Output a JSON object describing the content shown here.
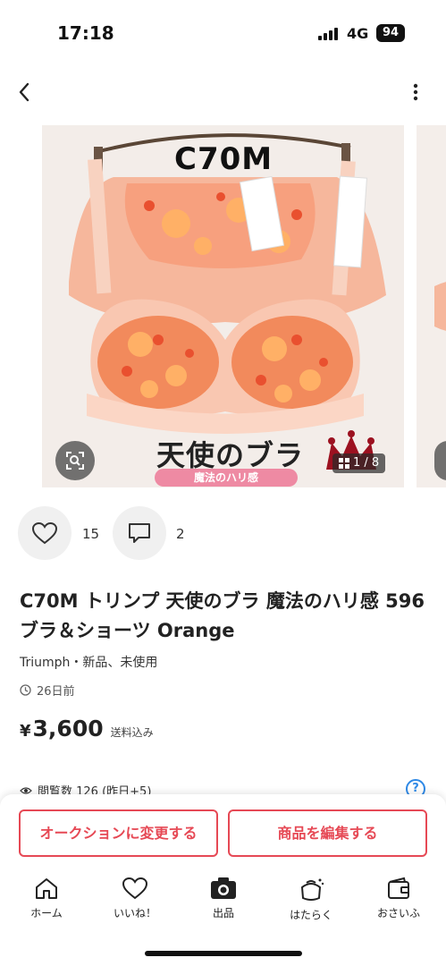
{
  "status_bar": {
    "time": "17:18",
    "network": "4G",
    "battery": "94"
  },
  "header": {
    "back_icon": "chevron-left-icon",
    "more_icon": "more-vertical-icon"
  },
  "photo": {
    "size_text": "C70M",
    "brand_text": "天使のブラ",
    "brand_sub_text": "魔法のハリ感",
    "counter": "1 / 8",
    "accent_pink": "#ee8aa3",
    "garment_color": "#f5b7a1",
    "flower_color": "#f06a3a"
  },
  "actions": {
    "likes": "15",
    "comments": "2"
  },
  "item": {
    "title": "C70M トリンプ 天使のブラ 魔法のハリ感 596 ブラ＆ショーツ Orange",
    "meta": "Triumph・新品、未使用",
    "time": "26日前",
    "price_symbol": "¥",
    "price": "3,600",
    "shipping_note": "送料込み",
    "views": "閲覧数  126 (昨日+5)"
  },
  "buttons": {
    "auction": "オークションに変更する",
    "edit": "商品を編集する"
  },
  "tabs": [
    {
      "label": "ホーム",
      "icon": "home-icon"
    },
    {
      "label": "いいね！",
      "icon": "heart-icon"
    },
    {
      "label": "出品",
      "icon": "camera-icon"
    },
    {
      "label": "はたらく",
      "icon": "work-bag-icon"
    },
    {
      "label": "おさいふ",
      "icon": "wallet-icon"
    }
  ],
  "colors": {
    "brand_red": "#e64955",
    "help_blue": "#2f89e6"
  }
}
